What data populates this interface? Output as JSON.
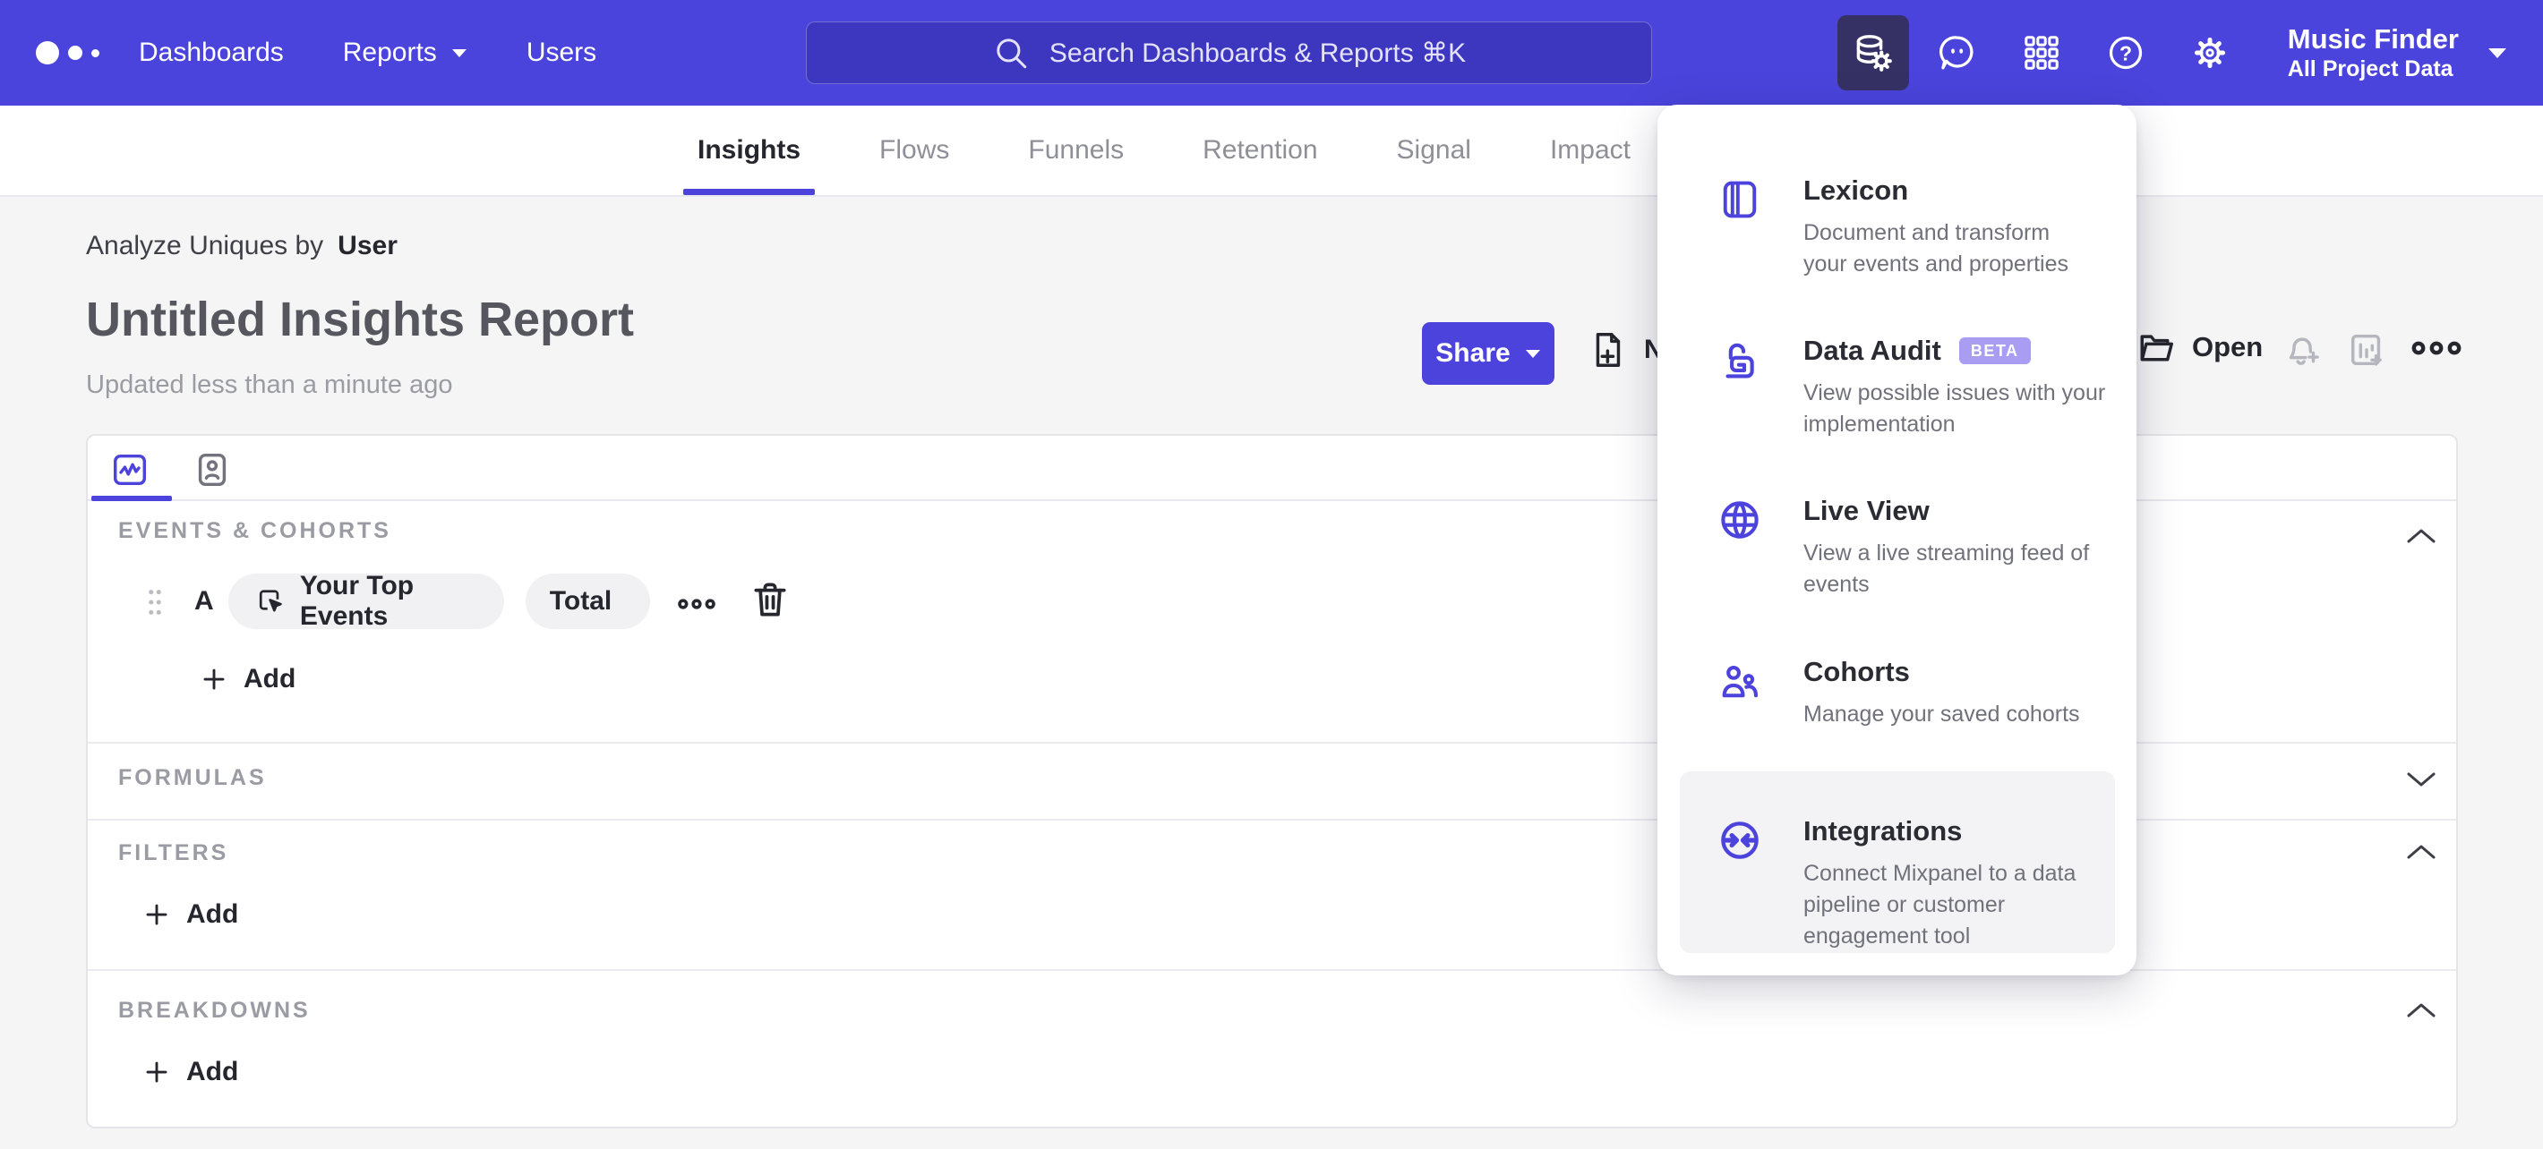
{
  "colors": {
    "nav_bg": "#4b44dc",
    "accent": "#4c43dc",
    "page_bg": "#f5f5f6",
    "badge_bg": "#a89df2",
    "active_icon_bg": "#363165"
  },
  "topnav": {
    "links": [
      {
        "label": "Dashboards"
      },
      {
        "label": "Reports",
        "has_caret": true
      },
      {
        "label": "Users"
      }
    ],
    "search_placeholder": "Search Dashboards & Reports ⌘K",
    "project": {
      "name": "Music Finder",
      "scope": "All Project Data"
    }
  },
  "tabs": [
    {
      "label": "Insights",
      "active": true
    },
    {
      "label": "Flows"
    },
    {
      "label": "Funnels"
    },
    {
      "label": "Retention"
    },
    {
      "label": "Signal"
    },
    {
      "label": "Impact"
    }
  ],
  "report": {
    "analyze_prefix": "Analyze Uniques by",
    "analyze_value": "User",
    "title": "Untitled Insights Report",
    "updated": "Updated less than a minute ago",
    "share_label": "Share",
    "new_label": "New",
    "open_label": "Open"
  },
  "builder": {
    "events": {
      "label": "EVENTS & COHORTS",
      "row": {
        "letter": "A",
        "event": "Your Top Events",
        "aggregation": "Total"
      },
      "add_label": "Add"
    },
    "formulas": {
      "label": "FORMULAS"
    },
    "filters": {
      "label": "FILTERS",
      "add_label": "Add"
    },
    "breakdowns": {
      "label": "BREAKDOWNS",
      "add_label": "Add"
    }
  },
  "menu": {
    "items": [
      {
        "title": "Lexicon",
        "desc": "Document and transform\nyour events and properties"
      },
      {
        "title": "Data Audit",
        "badge": "BETA",
        "desc": "View possible issues with your\nimplementation"
      },
      {
        "title": "Live View",
        "desc": "View a live streaming feed of\nevents"
      },
      {
        "title": "Cohorts",
        "desc": "Manage your saved cohorts"
      },
      {
        "title": "Integrations",
        "desc": "Connect Mixpanel to a data\npipeline or customer\nengagement tool"
      }
    ]
  }
}
